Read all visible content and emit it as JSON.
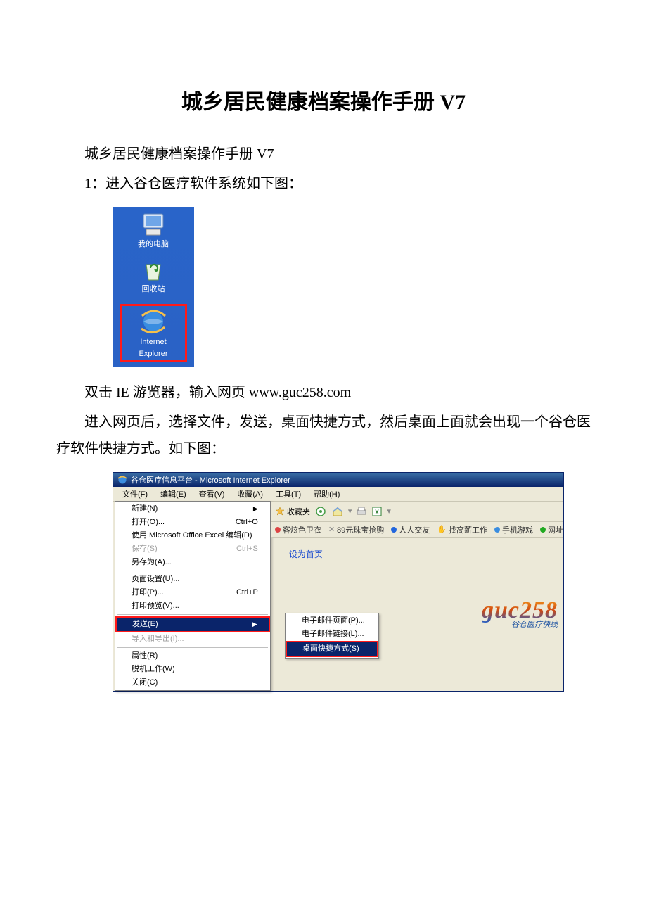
{
  "doc": {
    "title": "城乡居民健康档案操作手册 V7",
    "subtitle": "城乡居民健康档案操作手册 V7",
    "step1": "1：进入谷仓医疗软件系统如下图：",
    "instr1": "双击 IE 游览器，输入网页 www.guc258.com",
    "instr2": "进入网页后，选择文件，发送，桌面快捷方式，然后桌面上面就会出现一个谷仓医疗软件快捷方式。如下图："
  },
  "desktop": {
    "my_computer": "我的电脑",
    "recycle_bin": "回收站",
    "ie_line1": "Internet",
    "ie_line2": "Explorer"
  },
  "ie": {
    "title": "谷仓医疗信息平台 - Microsoft Internet Explorer",
    "menubar": {
      "file": "文件(F)",
      "edit": "编辑(E)",
      "view": "查看(V)",
      "favorites": "收藏(A)",
      "tools": "工具(T)",
      "help": "帮助(H)"
    },
    "file_menu": {
      "new": "新建(N)",
      "open": "打开(O)...",
      "open_sc": "Ctrl+O",
      "edit_excel": "使用 Microsoft Office Excel 编辑(D)",
      "save": "保存(S)",
      "save_sc": "Ctrl+S",
      "save_as": "另存为(A)...",
      "page_setup": "页面设置(U)...",
      "print": "打印(P)...",
      "print_sc": "Ctrl+P",
      "print_preview": "打印预览(V)...",
      "send": "发送(E)",
      "import_export": "导入和导出(I)...",
      "properties": "属性(R)",
      "work_offline": "脱机工作(W)",
      "close": "关闭(C)"
    },
    "send_submenu": {
      "email_page": "电子邮件页面(P)...",
      "email_link": "电子邮件链接(L)...",
      "desktop_shortcut": "桌面快捷方式(S)"
    },
    "toolbar": {
      "favorites_label": "收藏夹"
    },
    "links": {
      "l1": "客炫色卫衣",
      "l2": "89元珠宝抢购",
      "l3": "人人交友",
      "l4": "找高薪工作",
      "l5": "手机游戏",
      "l6": "网址"
    },
    "content": {
      "set_home": "设为首页",
      "logo": "guc258",
      "logo_sub": "谷仓医疗快线"
    }
  }
}
